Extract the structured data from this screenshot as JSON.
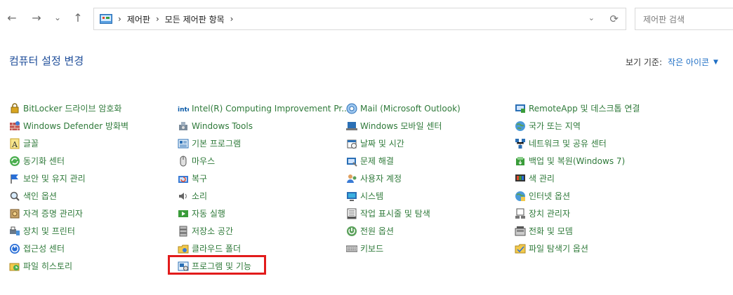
{
  "nav": {
    "back": "←",
    "forward": "→",
    "recent": "⌄",
    "up": "↑"
  },
  "address": {
    "crumbs": [
      "제어판",
      "모든 제어판 항목"
    ]
  },
  "search": {
    "placeholder": "제어판 검색"
  },
  "header": {
    "title": "컴퓨터 설정 변경",
    "view_by_label": "보기 기준:",
    "view_by_value": "작은 아이콘"
  },
  "columns": [
    [
      {
        "label": "BitLocker 드라이브 암호화",
        "icon": "bitlocker-icon"
      },
      {
        "label": "Windows Defender 방화벽",
        "icon": "firewall-icon"
      },
      {
        "label": "글꼴",
        "icon": "fonts-icon"
      },
      {
        "label": "동기화 센터",
        "icon": "sync-center-icon"
      },
      {
        "label": "보안 및 유지 관리",
        "icon": "security-maintenance-icon"
      },
      {
        "label": "색인 옵션",
        "icon": "indexing-icon"
      },
      {
        "label": "자격 증명 관리자",
        "icon": "credential-manager-icon"
      },
      {
        "label": "장치 및 프린터",
        "icon": "devices-printers-icon"
      },
      {
        "label": "접근성 센터",
        "icon": "ease-of-access-icon"
      },
      {
        "label": "파일 히스토리",
        "icon": "file-history-icon"
      }
    ],
    [
      {
        "label": "Intel(R) Computing Improvement Pr...",
        "icon": "intel-icon"
      },
      {
        "label": "Windows Tools",
        "icon": "windows-tools-icon"
      },
      {
        "label": "기본 프로그램",
        "icon": "default-programs-icon"
      },
      {
        "label": "마우스",
        "icon": "mouse-icon"
      },
      {
        "label": "복구",
        "icon": "recovery-icon"
      },
      {
        "label": "소리",
        "icon": "sound-icon"
      },
      {
        "label": "자동 실행",
        "icon": "autoplay-icon"
      },
      {
        "label": "저장소 공간",
        "icon": "storage-spaces-icon"
      },
      {
        "label": "클라우드 폴더",
        "icon": "cloud-folder-icon"
      },
      {
        "label": "프로그램 및 기능",
        "icon": "programs-features-icon"
      }
    ],
    [
      {
        "label": "Mail (Microsoft Outlook)",
        "icon": "mail-icon"
      },
      {
        "label": "Windows 모바일 센터",
        "icon": "mobility-center-icon"
      },
      {
        "label": "날짜 및 시간",
        "icon": "date-time-icon"
      },
      {
        "label": "문제 해결",
        "icon": "troubleshooting-icon"
      },
      {
        "label": "사용자 계정",
        "icon": "user-accounts-icon"
      },
      {
        "label": "시스템",
        "icon": "system-icon"
      },
      {
        "label": "작업 표시줄 및 탐색",
        "icon": "taskbar-icon"
      },
      {
        "label": "전원 옵션",
        "icon": "power-options-icon"
      },
      {
        "label": "키보드",
        "icon": "keyboard-icon"
      }
    ],
    [
      {
        "label": "RemoteApp 및 데스크톱 연결",
        "icon": "remoteapp-icon"
      },
      {
        "label": "국가 또는 지역",
        "icon": "region-icon"
      },
      {
        "label": "네트워크 및 공유 센터",
        "icon": "network-sharing-icon"
      },
      {
        "label": "백업 및 복원(Windows 7)",
        "icon": "backup-restore-icon"
      },
      {
        "label": "색 관리",
        "icon": "color-management-icon"
      },
      {
        "label": "인터넷 옵션",
        "icon": "internet-options-icon"
      },
      {
        "label": "장치 관리자",
        "icon": "device-manager-icon"
      },
      {
        "label": "전화 및 모뎀",
        "icon": "phone-modem-icon"
      },
      {
        "label": "파일 탐색기 옵션",
        "icon": "file-explorer-options-icon"
      }
    ]
  ],
  "colors": {
    "accent": "#1f6fc5",
    "title": "#1f4e9a",
    "link": "#2f7a3a",
    "highlight": "#e21b1b"
  }
}
